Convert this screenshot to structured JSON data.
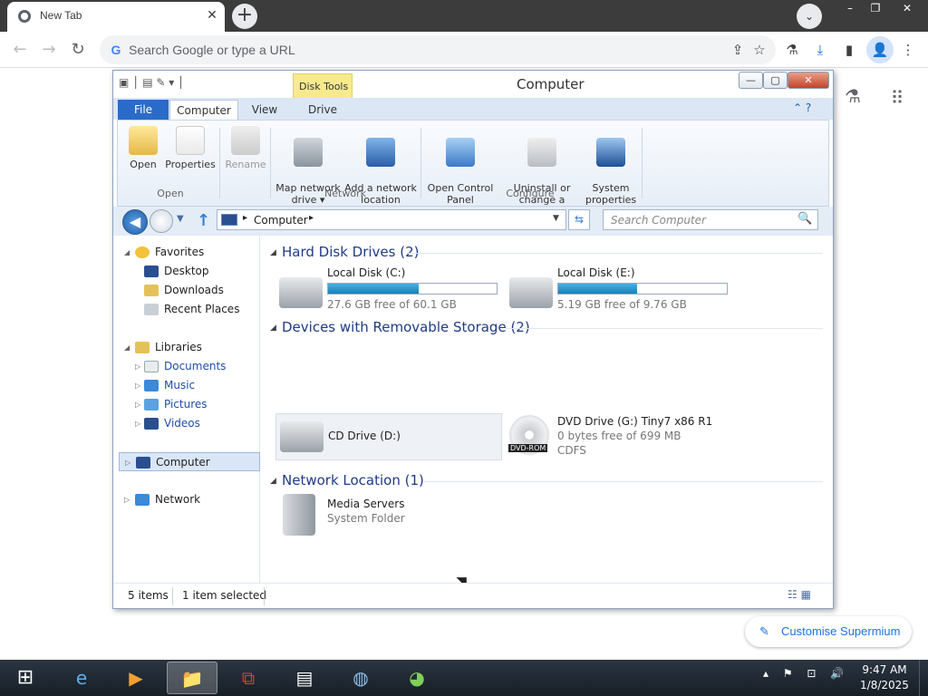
{
  "browser": {
    "tab_title": "New Tab",
    "tab_close": "✕",
    "new_tab": "+",
    "tab_search": "⌄",
    "window_controls": {
      "minimize": "–",
      "restore": "❐",
      "close": "✕"
    },
    "nav": {
      "back": "←",
      "forward": "→",
      "reload": "↻"
    },
    "omnibox_placeholder": "Search Google or type a URL",
    "google_g": "G",
    "toolbar_icons": {
      "share": "⇪",
      "bookmark": "☆",
      "labs": "⚗",
      "download": "⤓",
      "sidepanel": "▮",
      "menu": "⋮"
    },
    "profile": "👤",
    "customise_label": "Customise Supermium",
    "customise_icon": "✎",
    "labs_icon": "⚗",
    "apps_icon": "⠿"
  },
  "explorer": {
    "title": "Computer",
    "qat": "▣ │ ▤ ✎ ▾ │",
    "contextual_tab": "Disk Tools",
    "window_buttons": {
      "minimize": "—",
      "maximize": "▢",
      "close": "✕"
    },
    "ribbon_tabs": {
      "file": "File",
      "computer": "Computer",
      "view": "View",
      "drive": "Drive"
    },
    "ribbon_help": "⌃ ?",
    "ribbon": {
      "open_group": {
        "name": "Open",
        "open": "Open",
        "properties": "Properties"
      },
      "rename": "Rename",
      "network_group": {
        "name": "Network",
        "map_drive": "Map network\ndrive ▾",
        "add_location": "Add a network\nlocation"
      },
      "configure_group": {
        "name": "Configure",
        "control_panel": "Open Control\nPanel",
        "uninstall": "Uninstall or\nchange a program",
        "system_props": "System\nproperties"
      }
    },
    "address": {
      "path": "Computer",
      "chev": "▸",
      "search_placeholder": "Search Computer",
      "search_icon": "🔍",
      "refresh": "⇆",
      "back": "◀",
      "up": "↑",
      "dropdown": "▼",
      "history": "▼"
    },
    "nav_pane": {
      "favorites": "Favorites",
      "desktop": "Desktop",
      "downloads": "Downloads",
      "recent": "Recent Places",
      "libraries": "Libraries",
      "documents": "Documents",
      "music": "Music",
      "pictures": "Pictures",
      "videos": "Videos",
      "computer": "Computer",
      "network": "Network"
    },
    "groups": {
      "hdd": "Hard Disk Drives (2)",
      "removable": "Devices with Removable Storage (2)",
      "network": "Network Location (1)"
    },
    "drives": {
      "c": {
        "name": "Local Disk (C:)",
        "free": "27.6 GB free of 60.1 GB",
        "used_fraction": 0.54
      },
      "e": {
        "name": "Local Disk (E:)",
        "free": "5.19 GB free of 9.76 GB",
        "used_fraction": 0.47
      },
      "d": {
        "name": "CD Drive (D:)"
      },
      "g": {
        "name": "DVD Drive (G:) Tiny7 x86 R1",
        "free": "0 bytes free of 699 MB",
        "fs": "CDFS",
        "badge": "DVD-ROM"
      },
      "media": {
        "name": "Media Servers",
        "type": "System Folder"
      }
    },
    "status": {
      "items": "5 items",
      "selected": "1 item selected",
      "view_icons": "☷ ▦"
    }
  },
  "taskbar": {
    "start": "⊞",
    "apps": [
      "e",
      "▶",
      "📁",
      "⧉",
      "▤",
      "◍",
      "◕"
    ],
    "tray": "▴ ⚑ ⊡ 🔊",
    "time": "9:47 AM",
    "date": "1/8/2025"
  }
}
